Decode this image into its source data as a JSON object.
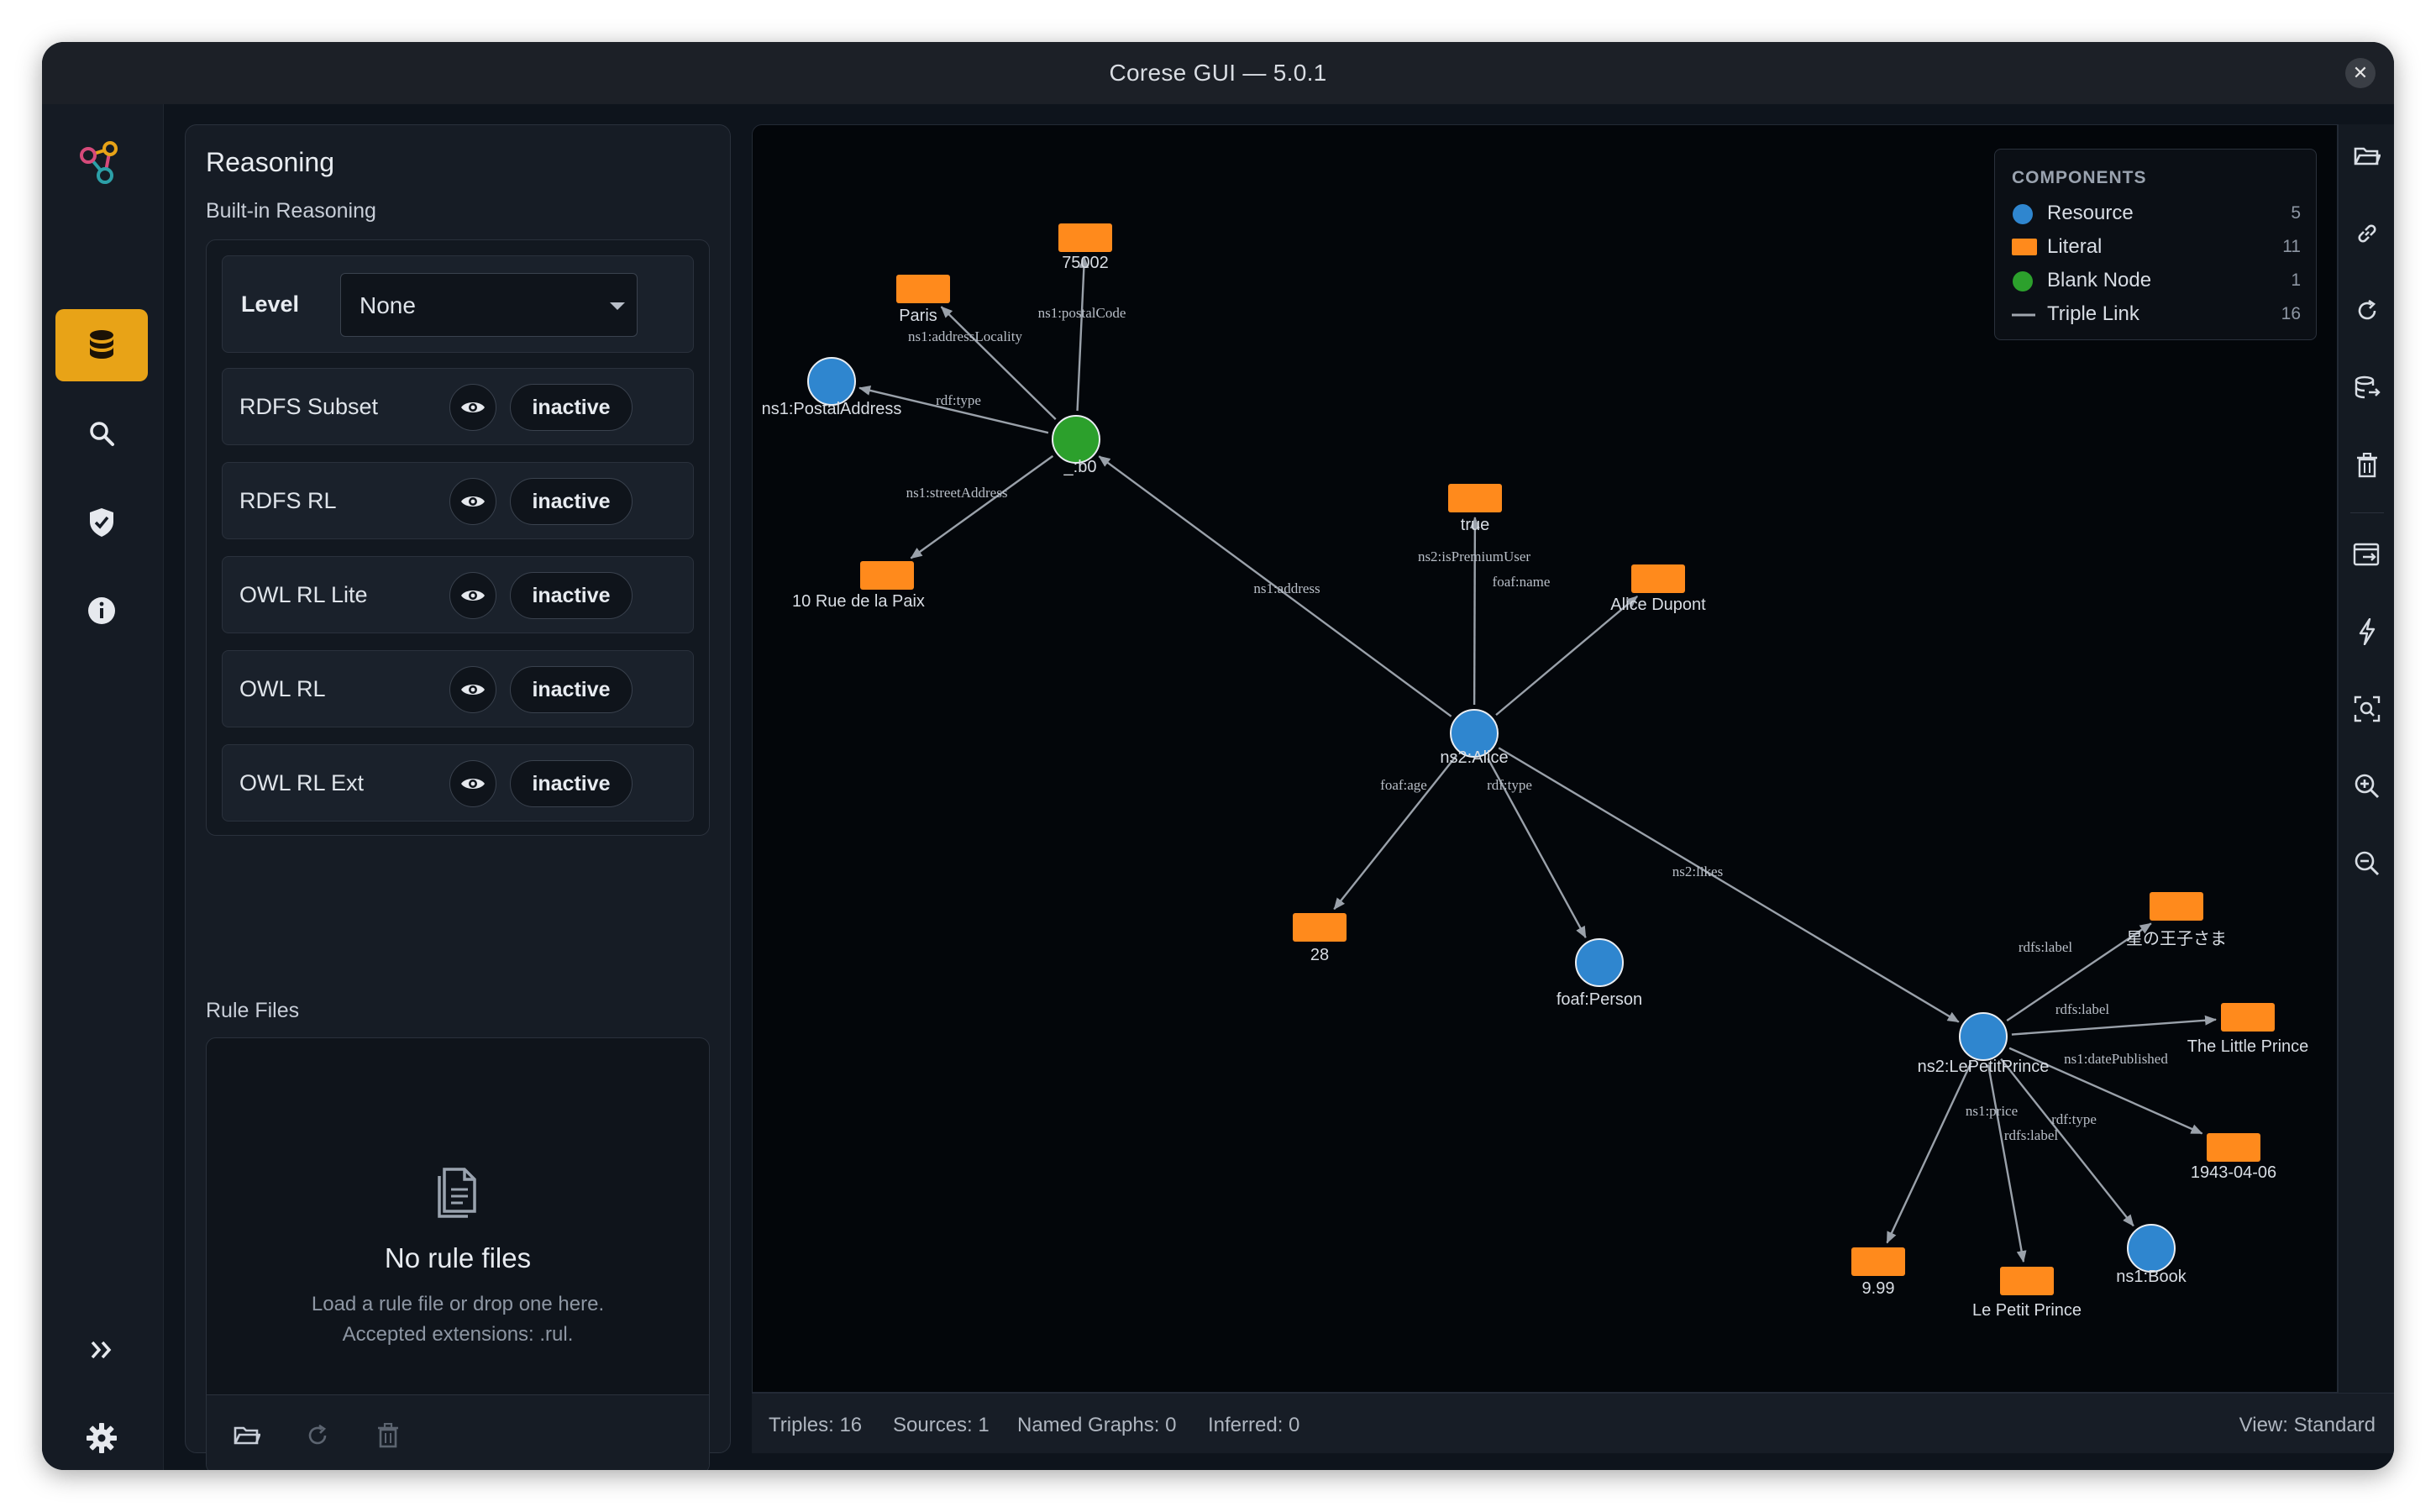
{
  "window": {
    "title": "Corese GUI — 5.0.1"
  },
  "rail": {
    "icons": [
      "graph-logo-icon",
      "database-icon",
      "search-icon",
      "shield-check-icon",
      "info-icon",
      "expand-icon",
      "gear-icon"
    ],
    "accent": "#e8a317"
  },
  "panel": {
    "title": "Reasoning",
    "builtin_label": "Built-in Reasoning",
    "level_label": "Level",
    "level_value": "None",
    "rules": [
      {
        "name": "RDFS Subset",
        "state": "inactive"
      },
      {
        "name": "RDFS RL",
        "state": "inactive"
      },
      {
        "name": "OWL RL Lite",
        "state": "inactive"
      },
      {
        "name": "OWL RL",
        "state": "inactive"
      },
      {
        "name": "OWL RL Ext",
        "state": "inactive"
      }
    ],
    "rule_files_label": "Rule Files",
    "empty_title": "No rule files",
    "empty_line1": "Load a rule file or drop one here.",
    "empty_line2": "Accepted extensions: .rul."
  },
  "legend": {
    "header": "COMPONENTS",
    "items": [
      {
        "name": "Resource",
        "count": "5",
        "color": "#2f86cf",
        "shape": "circle"
      },
      {
        "name": "Literal",
        "count": "11",
        "color": "#ff8a1c",
        "shape": "rect"
      },
      {
        "name": "Blank Node",
        "count": "1",
        "color": "#2ca02c",
        "shape": "circle"
      },
      {
        "name": "Triple Link",
        "count": "16",
        "color": "#a0a6ae",
        "shape": "line"
      }
    ]
  },
  "graph": {
    "colors": {
      "resource": "#2f86cf",
      "literal": "#ff8a1c",
      "blank": "#2ca02c",
      "edge": "#9aa1aa"
    },
    "nodes": [
      {
        "id": "alice",
        "label": "ns2:Alice",
        "kind": "resource"
      },
      {
        "id": "b0",
        "label": "_:b0",
        "kind": "blank"
      },
      {
        "id": "postal",
        "label": "ns1:PostalAddress",
        "kind": "resource"
      },
      {
        "id": "paris",
        "label": "Paris",
        "kind": "literal"
      },
      {
        "id": "zip",
        "label": "75002",
        "kind": "literal"
      },
      {
        "id": "street",
        "label": "10 Rue de la Paix",
        "kind": "literal"
      },
      {
        "id": "true",
        "label": "true",
        "kind": "literal"
      },
      {
        "id": "alicename",
        "label": "Alice Dupont",
        "kind": "literal"
      },
      {
        "id": "age",
        "label": "28",
        "kind": "literal"
      },
      {
        "id": "person",
        "label": "foaf:Person",
        "kind": "resource"
      },
      {
        "id": "lpp",
        "label": "ns2:LePetitPrince",
        "kind": "resource"
      },
      {
        "id": "jp",
        "label": "星の王子さま",
        "kind": "literal"
      },
      {
        "id": "tlp",
        "label": "The Little Prince",
        "kind": "literal"
      },
      {
        "id": "date",
        "label": "1943-04-06",
        "kind": "literal"
      },
      {
        "id": "book",
        "label": "ns1:Book",
        "kind": "resource"
      },
      {
        "id": "lppfr",
        "label": "Le Petit Prince",
        "kind": "literal"
      },
      {
        "id": "price",
        "label": "9.99",
        "kind": "literal"
      }
    ],
    "edges": [
      {
        "from": "alice",
        "to": "b0",
        "label": "ns1:address"
      },
      {
        "from": "b0",
        "to": "postal",
        "label": "rdf:type"
      },
      {
        "from": "b0",
        "to": "paris",
        "label": "ns1:addressLocality"
      },
      {
        "from": "b0",
        "to": "zip",
        "label": "ns1:postalCode"
      },
      {
        "from": "b0",
        "to": "street",
        "label": "ns1:streetAddress"
      },
      {
        "from": "alice",
        "to": "true",
        "label": "ns2:isPremiumUser"
      },
      {
        "from": "alice",
        "to": "alicename",
        "label": "foaf:name"
      },
      {
        "from": "alice",
        "to": "age",
        "label": "foaf:age"
      },
      {
        "from": "alice",
        "to": "person",
        "label": "rdf:type"
      },
      {
        "from": "alice",
        "to": "lpp",
        "label": "ns2:likes"
      },
      {
        "from": "lpp",
        "to": "jp",
        "label": "rdfs:label"
      },
      {
        "from": "lpp",
        "to": "tlp",
        "label": "rdfs:label"
      },
      {
        "from": "lpp",
        "to": "date",
        "label": "ns1:datePublished"
      },
      {
        "from": "lpp",
        "to": "book",
        "label": "rdf:type"
      },
      {
        "from": "lpp",
        "to": "lppfr",
        "label": "rdfs:label"
      },
      {
        "from": "lpp",
        "to": "price",
        "label": "ns1:price"
      }
    ]
  },
  "toolbar": {
    "icons": [
      "folder-open-icon",
      "link-icon",
      "refresh-icon",
      "database-export-icon",
      "trash-icon",
      "export-view-icon",
      "flash-icon",
      "zoom-fit-icon",
      "zoom-in-icon",
      "zoom-out-icon"
    ]
  },
  "status": {
    "triples": "Triples: 16",
    "sources": "Sources: 1",
    "named_graphs": "Named Graphs: 0",
    "inferred": "Inferred: 0",
    "view": "View: Standard"
  }
}
